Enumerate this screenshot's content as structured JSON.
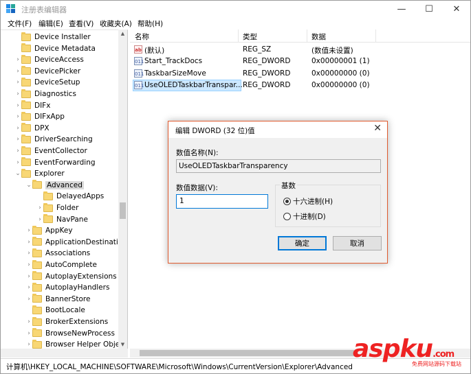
{
  "window": {
    "title": "注册表编辑器",
    "minimize": "—",
    "maximize": "☐",
    "close": "✕"
  },
  "menu": [
    "文件(F)",
    "编辑(E)",
    "查看(V)",
    "收藏夹(A)",
    "帮助(H)"
  ],
  "tree": {
    "items": [
      {
        "label": "Device Installer",
        "level": 1,
        "expander": "none"
      },
      {
        "label": "Device Metadata",
        "level": 1,
        "expander": "none"
      },
      {
        "label": "DeviceAccess",
        "level": 1,
        "expander": ">"
      },
      {
        "label": "DevicePicker",
        "level": 1,
        "expander": ">"
      },
      {
        "label": "DeviceSetup",
        "level": 1,
        "expander": ">"
      },
      {
        "label": "Diagnostics",
        "level": 1,
        "expander": ">"
      },
      {
        "label": "DIFx",
        "level": 1,
        "expander": ">"
      },
      {
        "label": "DIFxApp",
        "level": 1,
        "expander": ">"
      },
      {
        "label": "DPX",
        "level": 1,
        "expander": ">"
      },
      {
        "label": "DriverSearching",
        "level": 1,
        "expander": ">"
      },
      {
        "label": "EventCollector",
        "level": 1,
        "expander": ">"
      },
      {
        "label": "EventForwarding",
        "level": 1,
        "expander": ">"
      },
      {
        "label": "Explorer",
        "level": 1,
        "expander": "v"
      },
      {
        "label": "Advanced",
        "level": 2,
        "expander": "v",
        "selected": true
      },
      {
        "label": "DelayedApps",
        "level": 3,
        "expander": "none"
      },
      {
        "label": "Folder",
        "level": 3,
        "expander": ">"
      },
      {
        "label": "NavPane",
        "level": 3,
        "expander": ">"
      },
      {
        "label": "AppKey",
        "level": 2,
        "expander": ">"
      },
      {
        "label": "ApplicationDestinations",
        "level": 2,
        "expander": ">"
      },
      {
        "label": "Associations",
        "level": 2,
        "expander": ">"
      },
      {
        "label": "AutoComplete",
        "level": 2,
        "expander": ">"
      },
      {
        "label": "AutoplayExtensions",
        "level": 2,
        "expander": ">"
      },
      {
        "label": "AutoplayHandlers",
        "level": 2,
        "expander": ">"
      },
      {
        "label": "BannerStore",
        "level": 2,
        "expander": ">"
      },
      {
        "label": "BootLocale",
        "level": 2,
        "expander": "none"
      },
      {
        "label": "BrokerExtensions",
        "level": 2,
        "expander": ">"
      },
      {
        "label": "BrowseNewProcess",
        "level": 2,
        "expander": ">"
      },
      {
        "label": "Browser Helper Objects",
        "level": 2,
        "expander": ">"
      }
    ]
  },
  "list": {
    "headers": {
      "name": "名称",
      "type": "类型",
      "data": "数据"
    },
    "rows": [
      {
        "icon": "ab",
        "name": "(默认)",
        "type": "REG_SZ",
        "data": "(数值未设置)"
      },
      {
        "icon": "011",
        "name": "Start_TrackDocs",
        "type": "REG_DWORD",
        "data": "0x00000001 (1)"
      },
      {
        "icon": "011",
        "name": "TaskbarSizeMove",
        "type": "REG_DWORD",
        "data": "0x00000000 (0)"
      },
      {
        "icon": "011",
        "name": "UseOLEDTaskbarTranspar...",
        "type": "REG_DWORD",
        "data": "0x00000000 (0)",
        "selected": true
      }
    ]
  },
  "status": {
    "path": "计算机\\HKEY_LOCAL_MACHINE\\SOFTWARE\\Microsoft\\Windows\\CurrentVersion\\Explorer\\Advanced"
  },
  "dialog": {
    "title": "编辑 DWORD (32 位)值",
    "close": "✕",
    "name_label": "数值名称(N):",
    "name_value": "UseOLEDTaskbarTransparency",
    "data_label": "数值数据(V):",
    "data_value": "1",
    "base_label": "基数",
    "radio_hex": "十六进制(H)",
    "radio_dec": "十进制(D)",
    "ok": "确定",
    "cancel": "取消"
  },
  "watermark": {
    "text": "aspku",
    "suffix": ".com",
    "sub": "免费网站源码下载站"
  }
}
